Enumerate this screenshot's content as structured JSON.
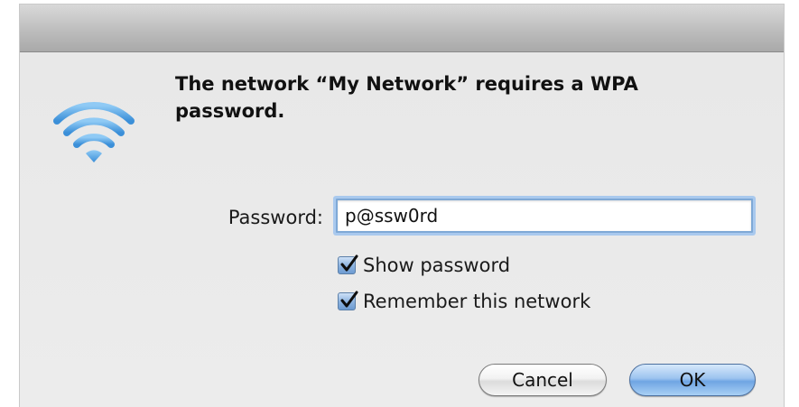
{
  "dialog": {
    "message": "The network “My Network” requires a WPA password.",
    "icon": "wifi-icon",
    "password_label": "Password:",
    "password_value": "p@ssw0rd",
    "show_password_label": "Show password",
    "show_password_checked": true,
    "remember_label": "Remember this network",
    "remember_checked": true,
    "cancel_label": "Cancel",
    "ok_label": "OK"
  },
  "colors": {
    "accent": "#5aa5e6",
    "window_bg": "#ececec",
    "focus_ring": "#a9c9ee"
  }
}
